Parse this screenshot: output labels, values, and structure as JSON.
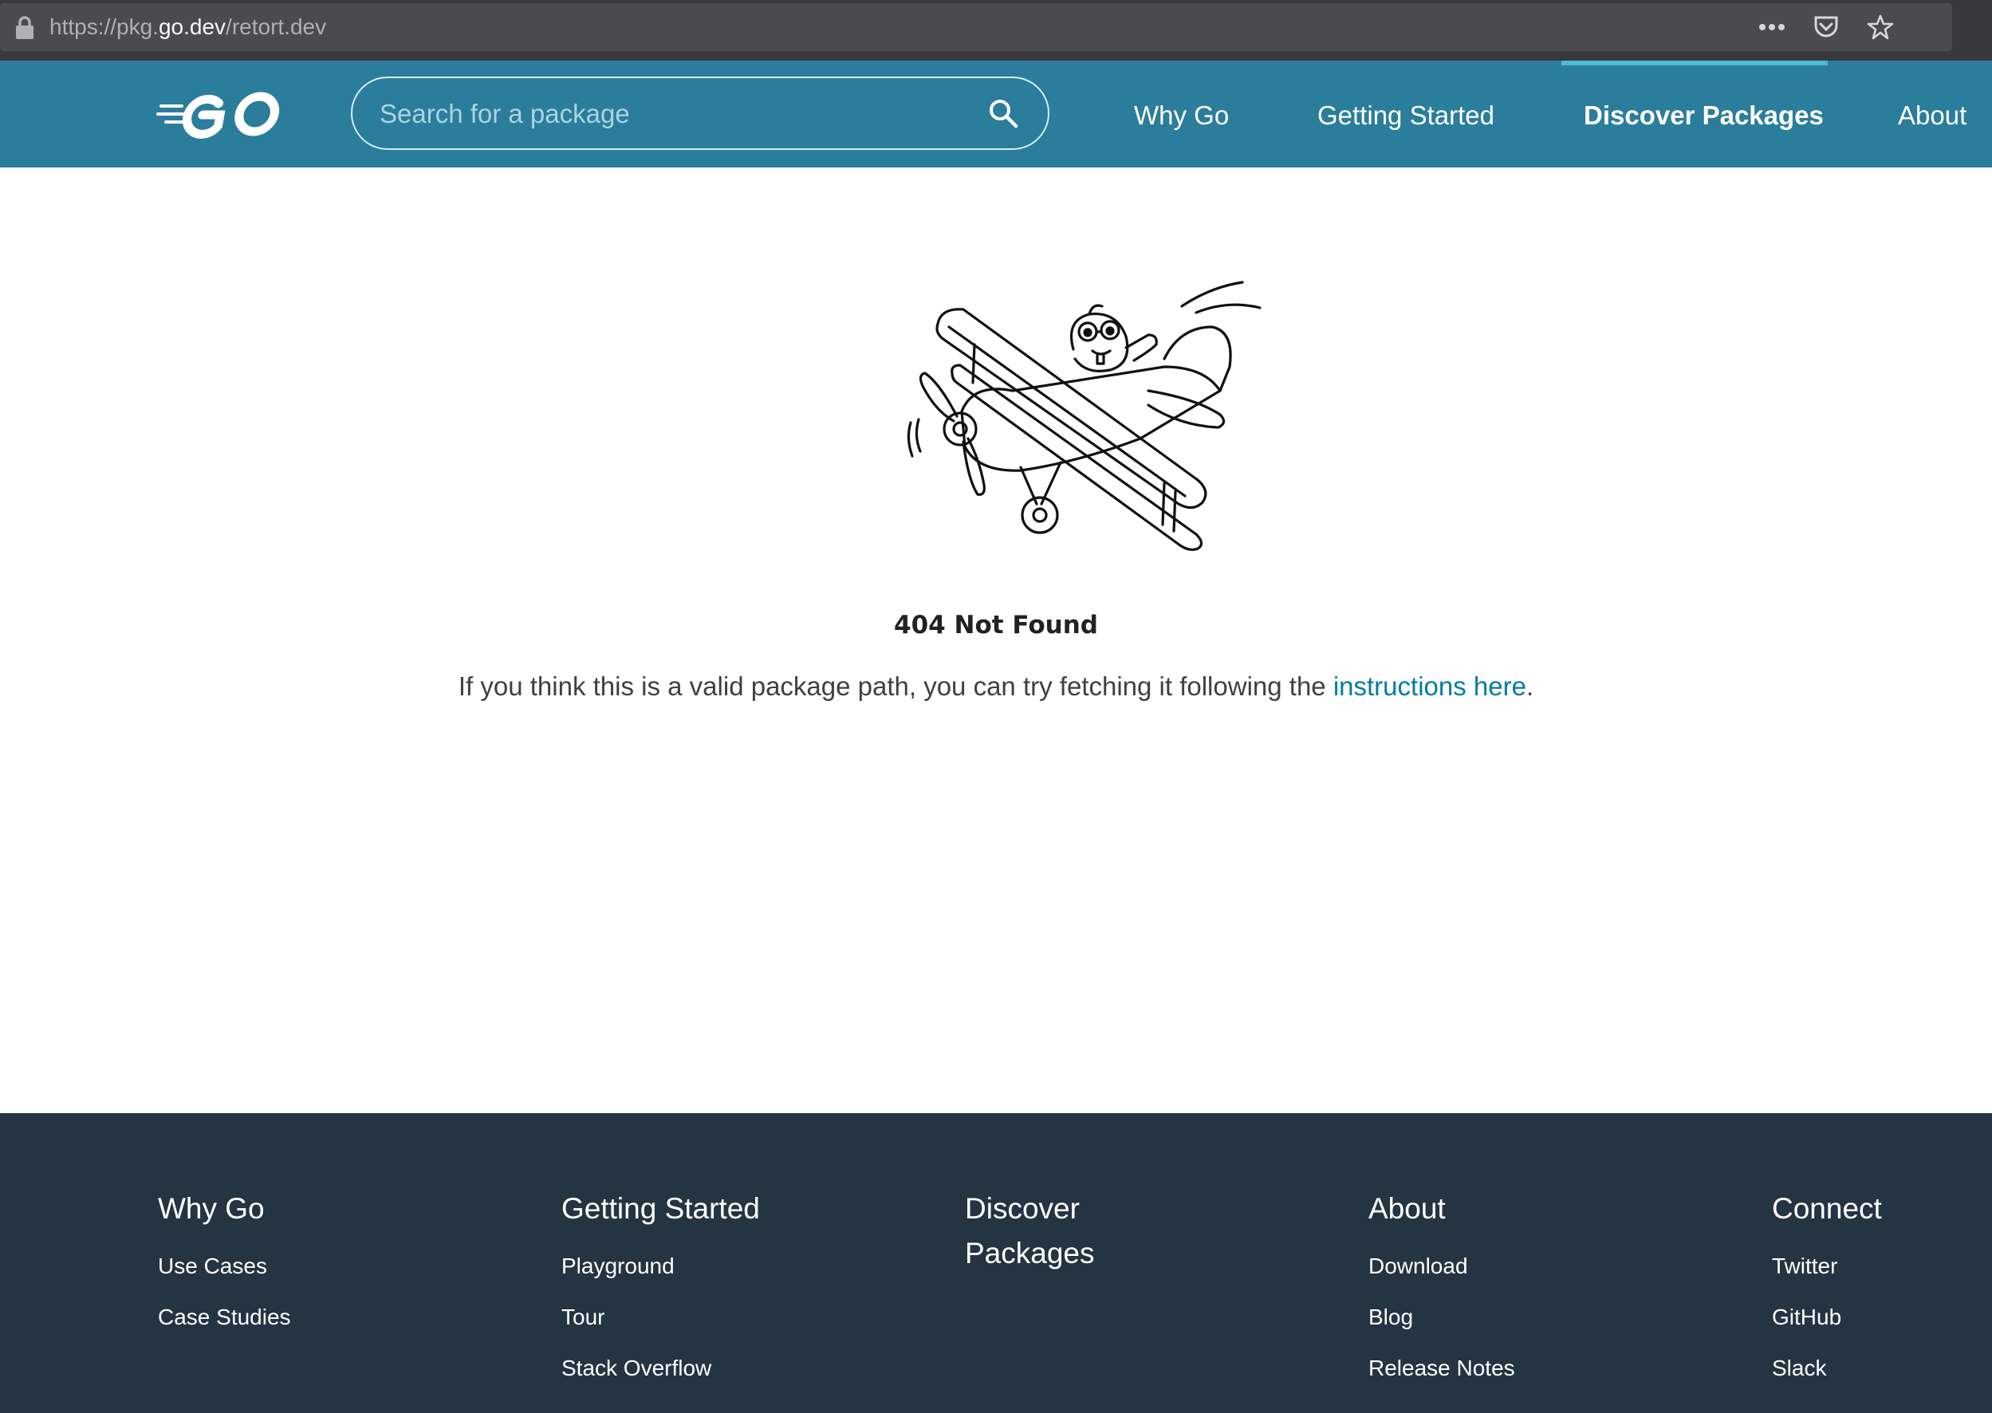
{
  "browser": {
    "url_scheme": "https://pkg.",
    "url_host": "go.dev",
    "url_path": "/retort.dev"
  },
  "header": {
    "search_placeholder": "Search for a package",
    "nav": [
      {
        "label": "Why Go",
        "active": false
      },
      {
        "label": "Getting Started",
        "active": false
      },
      {
        "label": "Discover Packages",
        "active": true
      },
      {
        "label": "About",
        "active": false
      }
    ]
  },
  "main": {
    "title": "404 Not Found",
    "message_prefix": "If you think this is a valid package path, you can try fetching it following the ",
    "message_link": "instructions here",
    "message_suffix": "."
  },
  "footer": {
    "columns": [
      {
        "heading": "Why Go",
        "links": [
          "Use Cases",
          "Case Studies"
        ]
      },
      {
        "heading": "Getting Started",
        "links": [
          "Playground",
          "Tour",
          "Stack Overflow"
        ]
      },
      {
        "heading": "Discover Packages",
        "links": []
      },
      {
        "heading": "About",
        "links": [
          "Download",
          "Blog",
          "Release Notes"
        ]
      },
      {
        "heading": "Connect",
        "links": [
          "Twitter",
          "GitHub",
          "Slack"
        ]
      }
    ]
  },
  "colors": {
    "header_bg": "#2b7d9c",
    "footer_bg": "#253443",
    "link": "#007d9c",
    "active_tab_indicator": "#4fb9d8"
  }
}
